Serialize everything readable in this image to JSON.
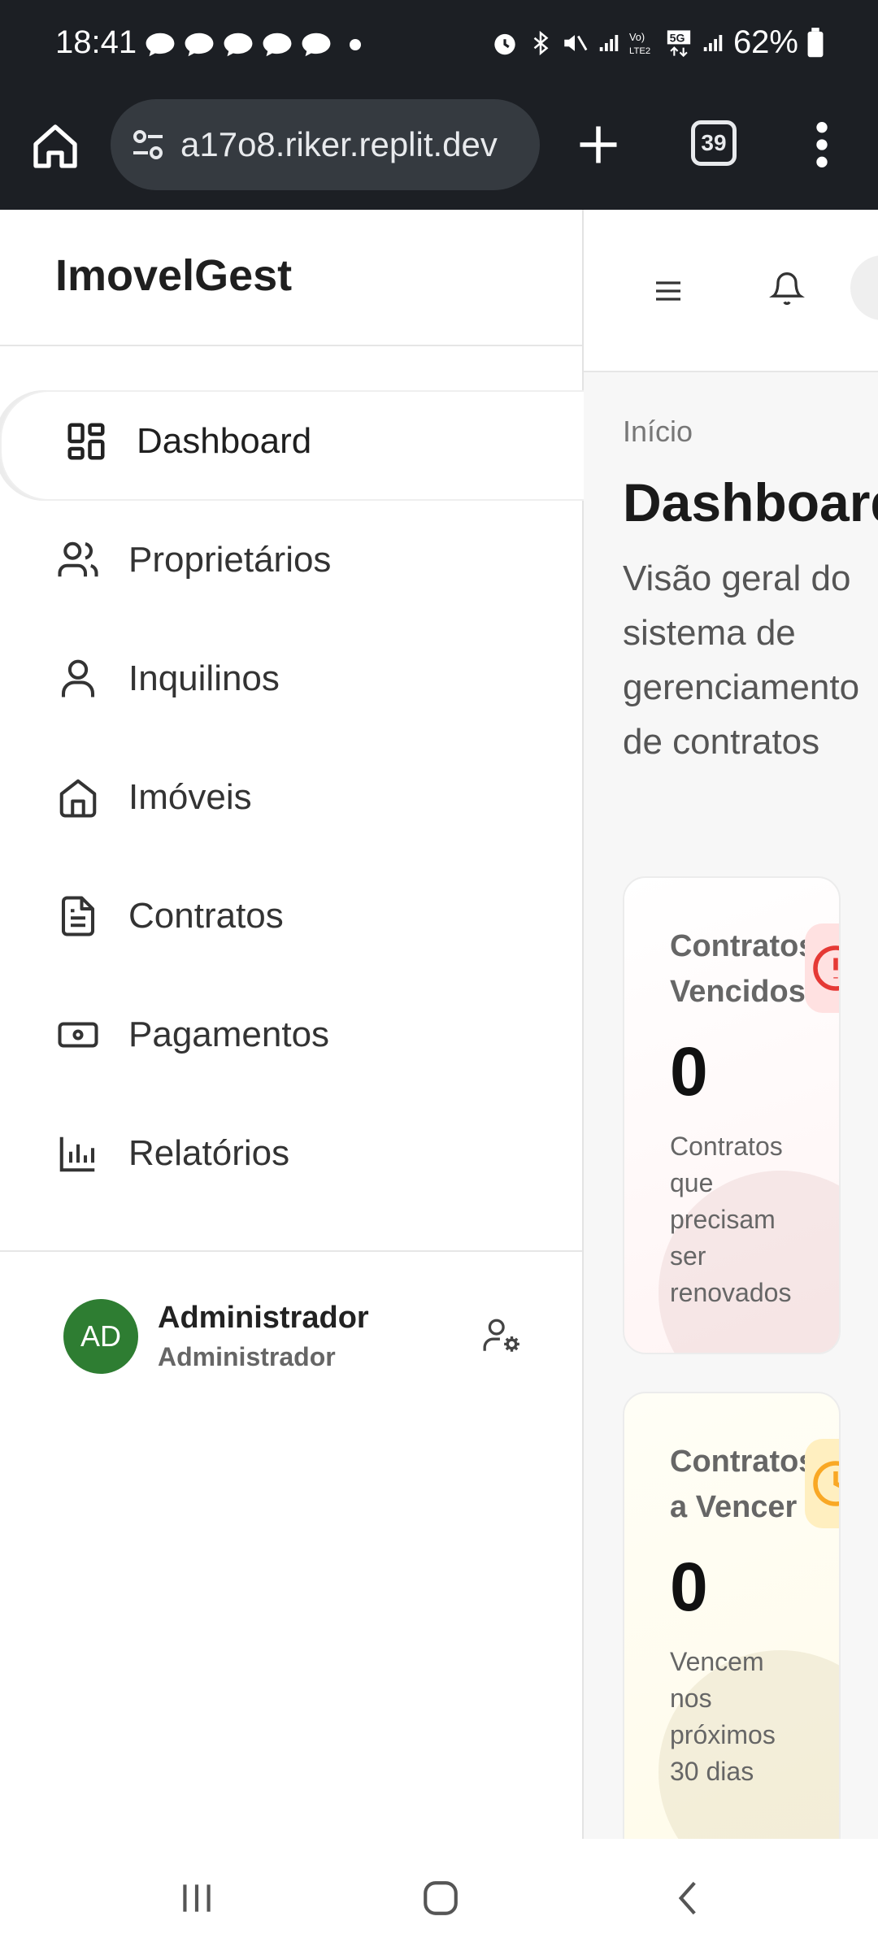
{
  "status_bar": {
    "time": "18:41",
    "battery": "62%",
    "notification_count": 5
  },
  "browser": {
    "url": "a17o8.riker.replit.dev",
    "tab_count": "39"
  },
  "sidebar": {
    "brand": "ImovelGest",
    "items": [
      {
        "label": "Dashboard",
        "icon": "grid-icon",
        "active": true
      },
      {
        "label": "Proprietários",
        "icon": "users-icon",
        "active": false
      },
      {
        "label": "Inquilinos",
        "icon": "user-icon",
        "active": false
      },
      {
        "label": "Imóveis",
        "icon": "home-icon",
        "active": false
      },
      {
        "label": "Contratos",
        "icon": "document-icon",
        "active": false
      },
      {
        "label": "Pagamentos",
        "icon": "banknote-icon",
        "active": false
      },
      {
        "label": "Relatórios",
        "icon": "bar-chart-icon",
        "active": false
      }
    ],
    "user": {
      "initials": "AD",
      "name": "Administrador",
      "role": "Administrador",
      "avatar_color": "#2e7d32"
    }
  },
  "main": {
    "breadcrumb": "Início",
    "title": "Dashboard",
    "subtitle": "Visão geral do sistema de gerenciamento de contratos",
    "cards": [
      {
        "title": "Contratos Vencidos",
        "value": "0",
        "description": "Contratos que precisam ser renovados",
        "icon": "alert-circle-icon",
        "accent": "#e53935"
      },
      {
        "title": "Contratos a Vencer",
        "value": "0",
        "description": "Vencem nos próximos 30 dias",
        "icon": "clock-icon",
        "accent": "#f9a825"
      }
    ]
  }
}
